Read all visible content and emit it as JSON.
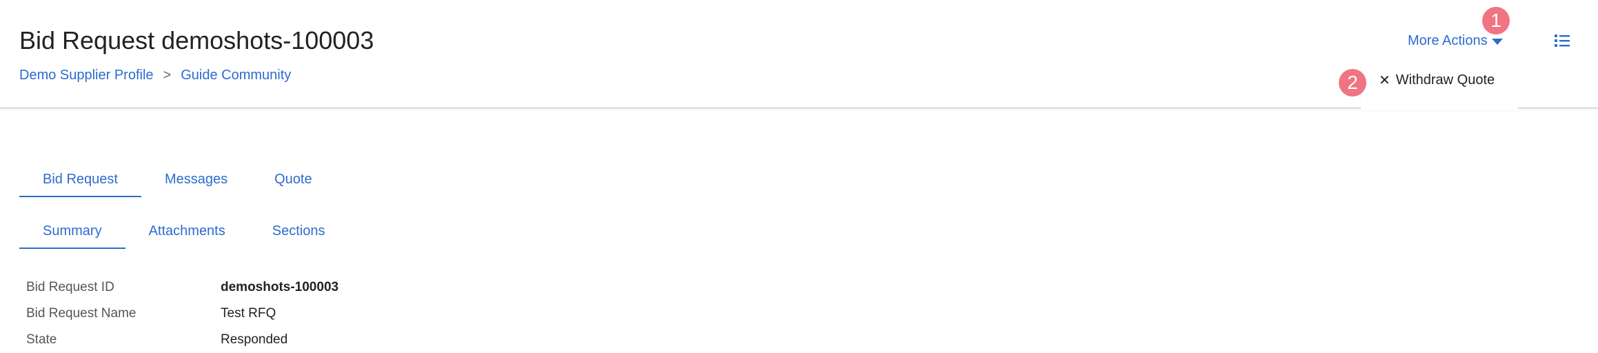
{
  "header": {
    "title": "Bid Request demoshots-100003",
    "breadcrumb": [
      {
        "label": "Demo Supplier Profile"
      },
      {
        "label": "Guide Community"
      }
    ],
    "breadcrumb_separator": ">",
    "more_actions_label": "More Actions",
    "list_icon": "list-icon",
    "accent_color": "#2d6bcf"
  },
  "dropdown": {
    "items": [
      {
        "icon": "close-icon",
        "glyph": "✕",
        "label": "Withdraw Quote"
      }
    ]
  },
  "step_badges": [
    "1",
    "2"
  ],
  "badge_color": "#f07482",
  "tabs": {
    "primary": [
      "Bid Request",
      "Messages",
      "Quote"
    ],
    "primary_active": "Bid Request",
    "secondary": [
      "Summary",
      "Attachments",
      "Sections"
    ],
    "secondary_active": "Summary"
  },
  "details": [
    {
      "label": "Bid Request ID",
      "value": "demoshots-100003"
    },
    {
      "label": "Bid Request Name",
      "value": "Test RFQ"
    },
    {
      "label": "State",
      "value": "Responded"
    }
  ]
}
